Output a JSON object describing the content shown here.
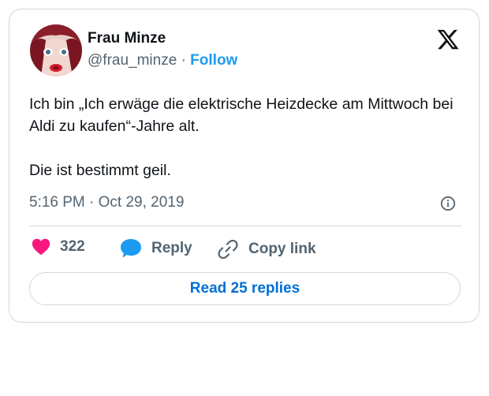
{
  "tweet": {
    "author_name": "Frau Minze",
    "handle": "@frau_minze",
    "separator": "·",
    "follow_label": "Follow",
    "text_lines": [
      "Ich bin „Ich erwäge die elektrische Heizdecke am Mittwoch bei Aldi zu kaufen“-Jahre alt.",
      "Die ist bestimmt geil."
    ],
    "timestamp": "5:16 PM · Oct 29, 2019",
    "like_count": "322",
    "reply_label": "Reply",
    "copy_link_label": "Copy link",
    "read_replies_label": "Read 25 replies"
  },
  "icons": {
    "logo": "x-logo-icon",
    "info": "info-icon",
    "like": "heart-icon",
    "reply": "reply-bubble-icon",
    "copy": "link-icon"
  },
  "colors": {
    "follow": "#1d9bf0",
    "like": "#f91880",
    "reply_icon": "#1d9bf0",
    "read_replies": "#006fd6",
    "muted": "#536471",
    "border": "#cfd9de"
  }
}
